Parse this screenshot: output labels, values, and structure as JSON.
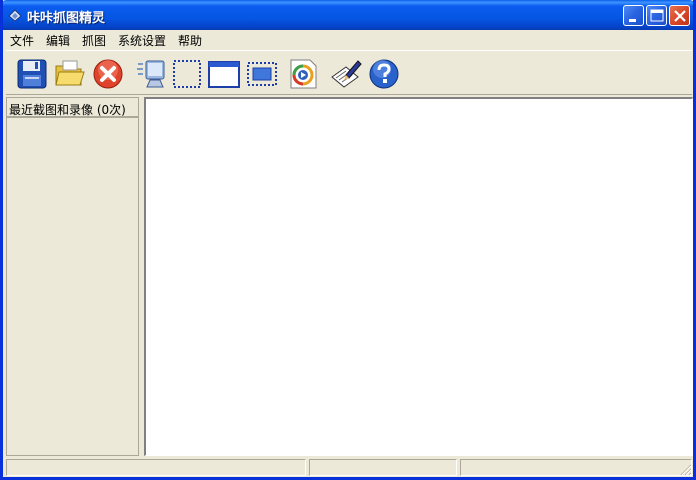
{
  "window": {
    "title": "咔咔抓图精灵",
    "icon": "app-camera-icon",
    "controls": [
      "minimize-icon",
      "maximize-icon",
      "close-icon"
    ]
  },
  "menu": {
    "items": [
      "文件",
      "编辑",
      "抓图",
      "系统设置",
      "帮助"
    ]
  },
  "toolbar": {
    "icons": [
      "save-icon",
      "open-folder-icon",
      "delete-icon",
      "capture-screen-icon",
      "capture-region-icon",
      "capture-window-icon",
      "capture-client-icon",
      "record-video-icon",
      "edit-pen-icon",
      "help-icon"
    ]
  },
  "sidebar": {
    "header": "最近截图和录像 (0次)"
  },
  "colors": {
    "titlebar": "#0656e4",
    "chrome": "#ece9d8",
    "canvas": "#ffffff"
  }
}
